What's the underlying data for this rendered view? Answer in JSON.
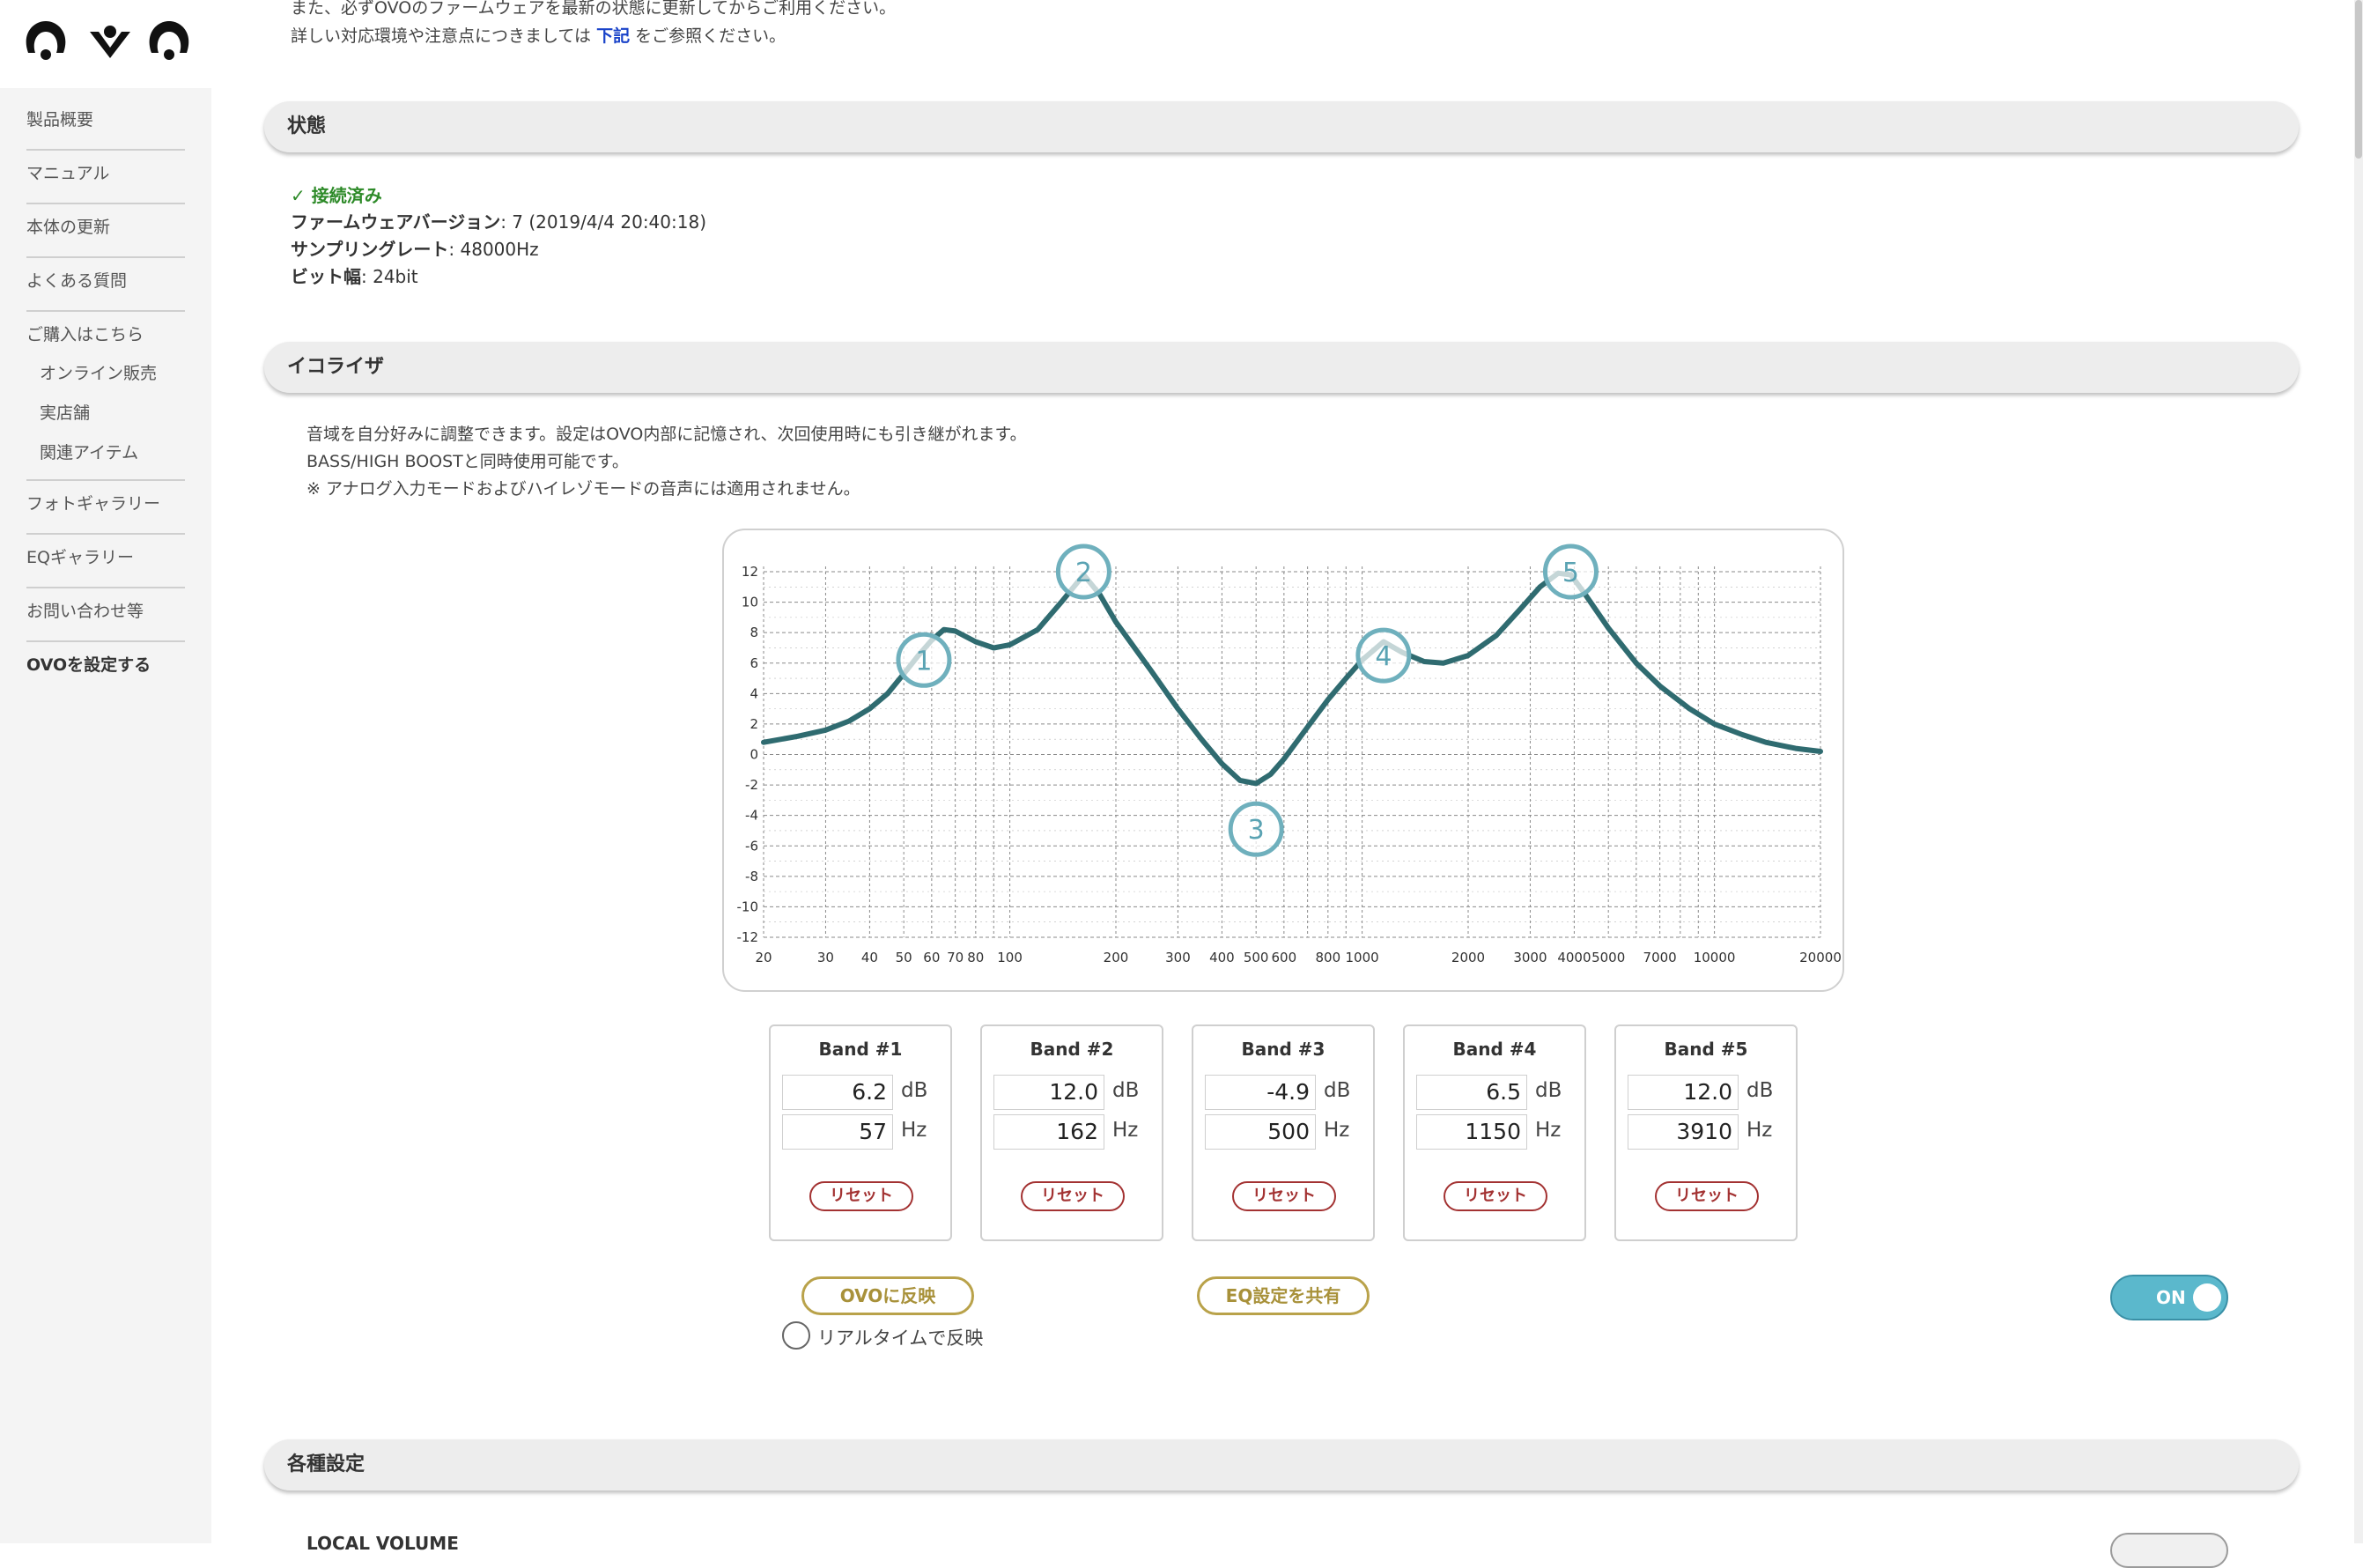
{
  "sidebar": {
    "items": [
      {
        "label": "製品概要"
      },
      {
        "label": "マニュアル"
      },
      {
        "label": "本体の更新"
      },
      {
        "label": "よくある質問"
      },
      {
        "label": "ご購入はこちら"
      }
    ],
    "subitems": [
      {
        "label": "オンライン販売"
      },
      {
        "label": "実店舗"
      },
      {
        "label": "関連アイテム"
      }
    ],
    "items2": [
      {
        "label": "フォトギャラリー"
      },
      {
        "label": "EQギャラリー"
      },
      {
        "label": "お問い合わせ等"
      },
      {
        "label": "OVOを設定する"
      }
    ]
  },
  "top_note": {
    "line1": "また、必ずOVOのファームウェアを最新の状態に更新してからご利用ください。",
    "line2_before": "詳しい対応環境や注意点につきましては ",
    "line2_link": "下記",
    "line2_after": " をご参照ください。"
  },
  "status": {
    "heading": "状態",
    "connected": "✓ 接続済み",
    "firmware_label": "ファームウェアバージョン",
    "firmware_value": ": 7 (2019/4/4 20:40:18)",
    "sampling_label": "サンプリングレート",
    "sampling_value": ": 48000Hz",
    "bitdepth_label": "ビット幅",
    "bitdepth_value": ": 24bit"
  },
  "equalizer": {
    "heading": "イコライザ",
    "desc1": "音域を自分好みに調整できます。設定はOVO内部に記憶され、次回使用時にも引き継がれます。",
    "desc2": "BASS/HIGH BOOSTと同時使用可能です。",
    "desc3": "※ アナログ入力モードおよびハイレゾモードの音声には適用されません。",
    "bands": [
      {
        "title": "Band #1",
        "db": "6.2",
        "hz": "57"
      },
      {
        "title": "Band #2",
        "db": "12.0",
        "hz": "162"
      },
      {
        "title": "Band #3",
        "db": "-4.9",
        "hz": "500"
      },
      {
        "title": "Band #4",
        "db": "6.5",
        "hz": "1150"
      },
      {
        "title": "Band #5",
        "db": "12.0",
        "hz": "3910"
      }
    ],
    "db_unit": "dB",
    "hz_unit": "Hz",
    "reset_label": "リセット",
    "apply_label": "OVOに反映",
    "share_label": "EQ設定を共有",
    "realtime_label": "リアルタイムで反映",
    "toggle_label": "ON",
    "toggle_on": true
  },
  "settings": {
    "heading": "各種設定",
    "local_volume": "LOCAL VOLUME"
  },
  "chart_data": {
    "type": "line",
    "x_scale": "log",
    "xlim": [
      20,
      20000
    ],
    "ylim": [
      -12,
      12
    ],
    "y_ticks": [
      12,
      10,
      8,
      6,
      4,
      2,
      0,
      -2,
      -4,
      -6,
      -8,
      -10,
      -12
    ],
    "x_tick_labels": [
      {
        "v": 20,
        "t": "20"
      },
      {
        "v": 30,
        "t": "30"
      },
      {
        "v": 40,
        "t": "40"
      },
      {
        "v": 50,
        "t": "50"
      },
      {
        "v": 60,
        "t": "60"
      },
      {
        "v": 70,
        "t": "70"
      },
      {
        "v": 80,
        "t": "80"
      },
      {
        "v": 100,
        "t": "100"
      },
      {
        "v": 200,
        "t": "200"
      },
      {
        "v": 300,
        "t": "300"
      },
      {
        "v": 400,
        "t": "400"
      },
      {
        "v": 500,
        "t": "500"
      },
      {
        "v": 600,
        "t": "600"
      },
      {
        "v": 800,
        "t": "800"
      },
      {
        "v": 1000,
        "t": "1000"
      },
      {
        "v": 2000,
        "t": "2000"
      },
      {
        "v": 3000,
        "t": "3000"
      },
      {
        "v": 4000,
        "t": "4000"
      },
      {
        "v": 5000,
        "t": "5000"
      },
      {
        "v": 7000,
        "t": "7000"
      },
      {
        "v": 10000,
        "t": "10000"
      },
      {
        "v": 20000,
        "t": "20000"
      }
    ],
    "grid": true,
    "curve": {
      "x": [
        20,
        25,
        30,
        35,
        40,
        45,
        50,
        55,
        60,
        65,
        70,
        80,
        90,
        100,
        120,
        140,
        162,
        180,
        200,
        250,
        300,
        350,
        400,
        450,
        500,
        550,
        600,
        700,
        800,
        900,
        1000,
        1150,
        1300,
        1500,
        1700,
        2000,
        2400,
        2800,
        3200,
        3600,
        3910,
        4300,
        5000,
        6000,
        7000,
        8500,
        10000,
        12000,
        14000,
        17000,
        20000
      ],
      "y": [
        0.8,
        1.2,
        1.6,
        2.2,
        3.0,
        4.0,
        5.3,
        6.5,
        7.5,
        8.2,
        8.1,
        7.4,
        7.0,
        7.2,
        8.2,
        10.0,
        11.8,
        10.5,
        8.7,
        5.6,
        3.0,
        1.0,
        -0.6,
        -1.7,
        -1.9,
        -1.3,
        -0.3,
        1.8,
        3.6,
        5.0,
        6.2,
        7.4,
        6.7,
        6.1,
        6.0,
        6.5,
        7.8,
        9.5,
        11.0,
        11.9,
        11.8,
        10.5,
        8.3,
        6.0,
        4.5,
        3.0,
        2.0,
        1.3,
        0.8,
        0.4,
        0.2
      ]
    },
    "handles": [
      {
        "label": "1",
        "x": 57,
        "y": 6.2
      },
      {
        "label": "2",
        "x": 162,
        "y": 12.0
      },
      {
        "label": "3",
        "x": 500,
        "y": -4.9
      },
      {
        "label": "4",
        "x": 1150,
        "y": 6.5
      },
      {
        "label": "5",
        "x": 3910,
        "y": 12.0
      }
    ],
    "colors": {
      "curve": "#2f6b70",
      "handle_stroke": "#6fb0bd",
      "grid": "#8a8a8a"
    }
  }
}
